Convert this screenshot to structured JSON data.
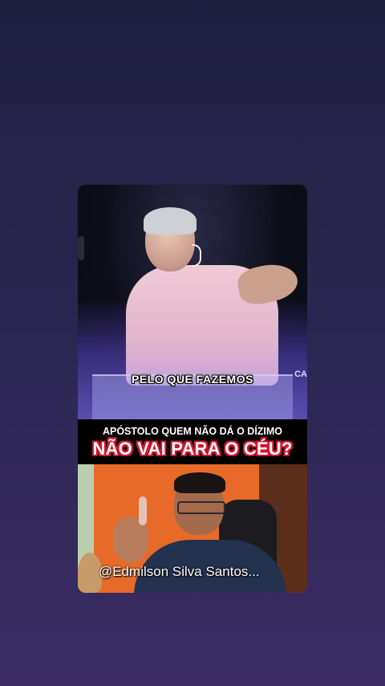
{
  "top_video": {
    "subtitle": "PELO QUE FAZEMOS",
    "corner_text": "CA"
  },
  "title_band": {
    "line1": "APÓSTOLO QUEM NÃO DÁ O DÍZIMO",
    "line2": "NÃO VAI PARA O CÉU?"
  },
  "bottom_video": {
    "handle": "@Edmilson Silva Santos..."
  },
  "colors": {
    "background_top": "#20203f",
    "background_bottom": "#3b2c66",
    "title_red": "#d4142f",
    "orange_wall": "#e86a28"
  }
}
